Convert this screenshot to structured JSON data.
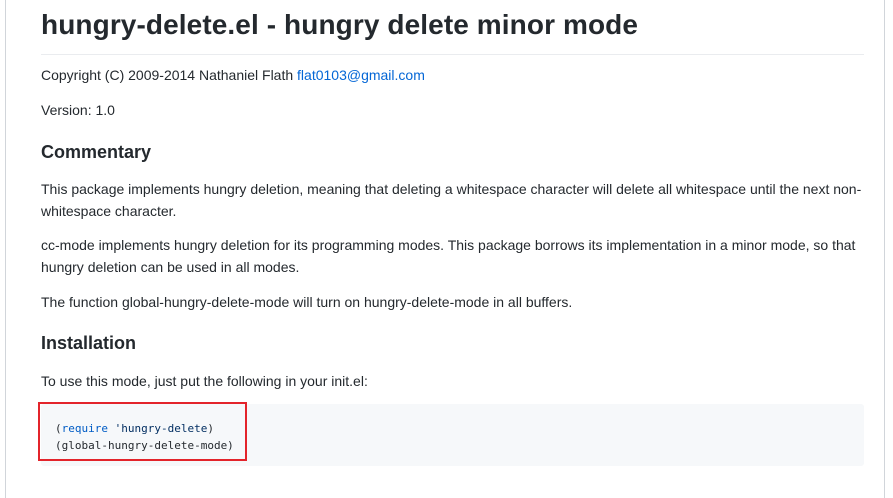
{
  "readme": {
    "title": "hungry-delete.el - hungry delete minor mode",
    "copyright_text": "Copyright (C) 2009-2014 Nathaniel Flath ",
    "copyright_email": "flat0103@gmail.com",
    "version": "Version: 1.0",
    "commentary_heading": "Commentary",
    "commentary_p1": "This package implements hungry deletion, meaning that deleting a whitespace character will delete all whitespace until the next non-whitespace character.",
    "commentary_p2": "cc-mode implements hungry deletion for its programming modes. This package borrows its implementation in a minor mode, so that hungry deletion can be used in all modes.",
    "commentary_p3": "The function global-hungry-delete-mode will turn on hungry-delete-mode in all buffers.",
    "installation_heading": "Installation",
    "installation_p1": "To use this mode, just put the following in your init.el:",
    "code": {
      "line1_open": "(",
      "line1_keyword": "require",
      "line1_space": " ",
      "line1_string": "'hungry-delete",
      "line1_close": ")",
      "line2": "(global-hungry-delete-mode)"
    }
  },
  "colors": {
    "link": "#0366d6",
    "highlight_border": "#e3242b",
    "code_bg": "#f6f8fa"
  }
}
